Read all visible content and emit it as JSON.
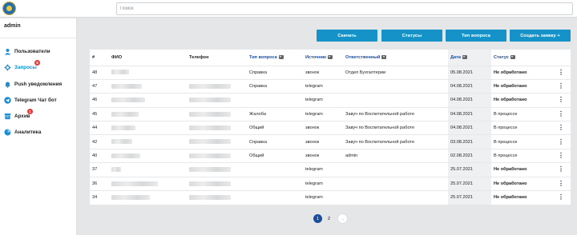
{
  "search": {
    "placeholder": "Поиск"
  },
  "sidebar": {
    "user": "admin",
    "items": [
      {
        "label": "Пользователи",
        "icon": "users-icon"
      },
      {
        "label": "Запросы",
        "icon": "requests-icon",
        "badge": "6",
        "active": true
      },
      {
        "label": "Push уведомления",
        "icon": "bell-icon"
      },
      {
        "label": "Telegram Чат бот",
        "icon": "telegram-icon"
      },
      {
        "label": "Архив",
        "icon": "archive-icon",
        "badge": "1"
      },
      {
        "label": "Аналитика",
        "icon": "analytics-icon"
      }
    ]
  },
  "toolbar": {
    "download": "Скачать",
    "statuses": "Статусы",
    "request_type": "Тип вопроса",
    "create": "Создать заявку +"
  },
  "table": {
    "headers": {
      "num": "#",
      "fio": "ФИО",
      "phone": "Телефон",
      "type": "Тип вопроса",
      "source": "Источник",
      "responsible": "Ответственный",
      "date": "Дата",
      "status": "Статус"
    },
    "rows": [
      {
        "num": "48",
        "type": "Справка",
        "source": "звонок",
        "responsible": "Отдел Бухгалтерии",
        "date": "05.08.2021",
        "status": "Не обработано"
      },
      {
        "num": "47",
        "type": "Справка",
        "source": "telegram",
        "responsible": "",
        "date": "04.08.2021",
        "status": "Не обработано"
      },
      {
        "num": "46",
        "type": "",
        "source": "telegram",
        "responsible": "",
        "date": "04.08.2021",
        "status": "Не обработано"
      },
      {
        "num": "45",
        "type": "Жалоба",
        "source": "telegram",
        "responsible": "Завуч по Воспитательной работе",
        "date": "04.08.2021",
        "status": "В процессе"
      },
      {
        "num": "44",
        "type": "Общий",
        "source": "звонок",
        "responsible": "Завуч по Воспитательной работе",
        "date": "04.08.2021",
        "status": "В процессе"
      },
      {
        "num": "42",
        "type": "Справка",
        "source": "звонок",
        "responsible": "Завуч по Воспитательной работе",
        "date": "03.08.2021",
        "status": "В процессе"
      },
      {
        "num": "40",
        "type": "Общий",
        "source": "звонок",
        "responsible": "admin",
        "date": "02.08.2021",
        "status": "В процессе"
      },
      {
        "num": "37",
        "type": "",
        "source": "telegram",
        "responsible": "",
        "date": "25.07.2021",
        "status": "Не обработано"
      },
      {
        "num": "36",
        "type": "",
        "source": "telegram",
        "responsible": "",
        "date": "25.07.2021",
        "status": "Не обработано"
      },
      {
        "num": "34",
        "type": "",
        "source": "telegram",
        "responsible": "",
        "date": "25.07.2021",
        "status": "Не обработано"
      }
    ]
  },
  "pagination": {
    "pages": [
      "1",
      "2"
    ],
    "current": "1",
    "next": "→"
  },
  "colors": {
    "accent": "#1593c9",
    "header_link": "#1a4d9c",
    "badge": "#e03a3a"
  }
}
